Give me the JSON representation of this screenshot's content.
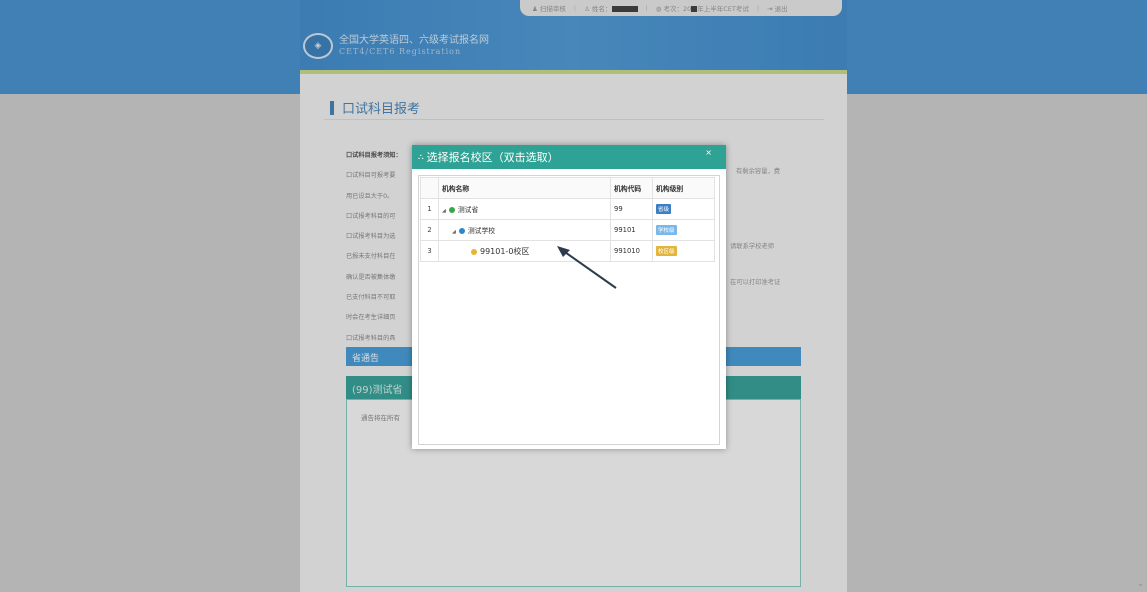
{
  "topbar": {
    "items": [
      {
        "icon": "user-card-icon",
        "text": "扫描审核"
      },
      {
        "icon": "person-icon",
        "text": "姓名："
      },
      {
        "icon": "globe-icon",
        "text": "考次：20",
        "text2": "年上半年CET考试"
      },
      {
        "icon": "exit-icon",
        "text": "退出"
      }
    ]
  },
  "site": {
    "title": "全国大学英语四、六级考试报名网",
    "subtitle": "CET4/CET6  Registration"
  },
  "section": {
    "title": "口试科目报考"
  },
  "notice": {
    "lines": [
      "口试科目报考须知：",
      "口试科目可报考要",
      "用已设且大于0。",
      "口试报考科目的可",
      "口试报考科目为选",
      "已报未支付科目在",
      "确认是否被集体缴",
      "已支付科目不可取",
      "时会在考生详细页",
      "口试报考科目的具"
    ],
    "right_fragments": [
      "有剩余容量，费",
      "请联系学校老师",
      "在可以打印准考证"
    ]
  },
  "province_bar": "省通告",
  "province_head": "(99)测试省",
  "province_text": "通告将在所有",
  "dialog": {
    "title": "选择报名校区（双击选取）",
    "close": "×",
    "columns": [
      "机构名称",
      "机构代码",
      "机构级别"
    ],
    "rows": [
      {
        "index": "1",
        "name": "测试省",
        "code": "99",
        "level": "省级",
        "level_color": "#3c7fc4",
        "dot_color": "#3aa64a"
      },
      {
        "index": "2",
        "name": "测试学校",
        "code": "99101",
        "level": "学校级",
        "level_color": "#7ab7ea",
        "dot_color": "#2f86c9"
      },
      {
        "index": "3",
        "name": "99101-0校区",
        "code": "991010",
        "level": "校区级",
        "level_color": "#e3b63b",
        "dot_color": "#e7b52e"
      }
    ]
  }
}
